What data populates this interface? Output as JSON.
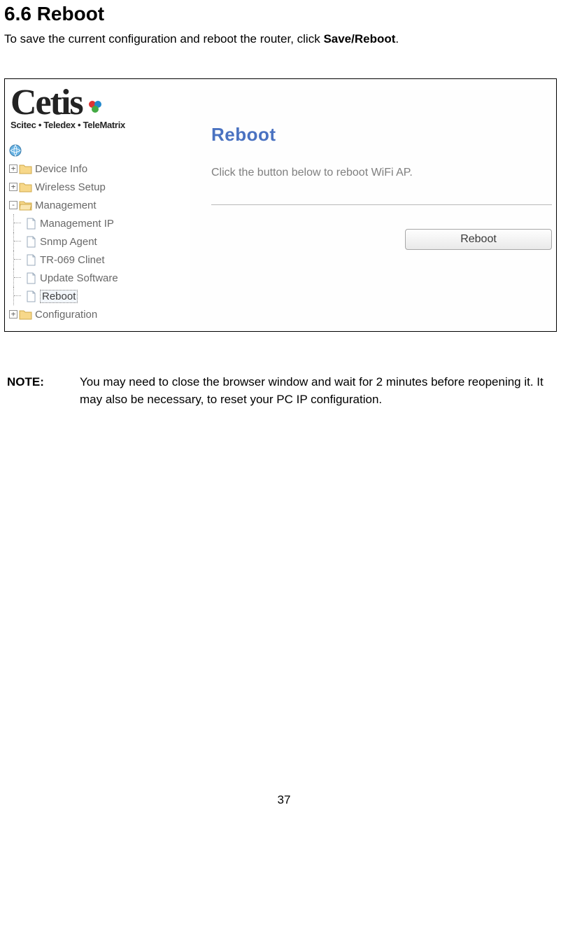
{
  "section": {
    "heading": "6.6 Reboot",
    "intro_pre": "To save the current configuration and reboot the router, click ",
    "intro_bold": "Save/Reboot",
    "intro_post": "."
  },
  "brand": {
    "name": "Cetis",
    "subtitle": "Scitec • Teledex • TeleMatrix"
  },
  "tree": {
    "items": [
      {
        "label": "Device Info"
      },
      {
        "label": "Wireless Setup"
      },
      {
        "label": "Management"
      },
      {
        "label": "Management IP"
      },
      {
        "label": "Snmp Agent"
      },
      {
        "label": "TR-069 Clinet"
      },
      {
        "label": "Update Software"
      },
      {
        "label": "Reboot"
      },
      {
        "label": "Configuration"
      }
    ]
  },
  "panel": {
    "heading": "Reboot",
    "description": "Click the button below to reboot WiFi AP.",
    "button_label": "Reboot"
  },
  "note": {
    "label": "NOTE:",
    "text": "You may need to close the browser window and wait for 2 minutes before reopening it. It may also be necessary, to reset your PC IP configuration."
  },
  "page_number": "37"
}
